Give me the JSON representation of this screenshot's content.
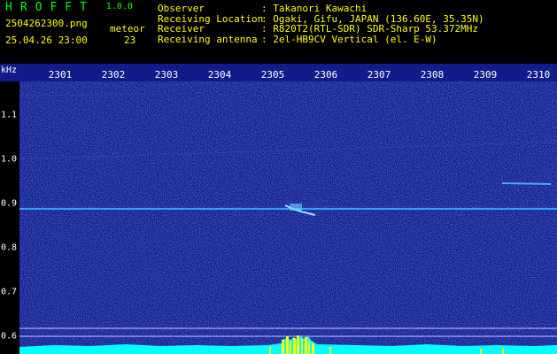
{
  "header": {
    "app_name": "HROFFT",
    "app_version": "1.0.0",
    "file_name": "2504262300.png",
    "datetime": "25.04.26 23:00",
    "meteor_label": "meteor",
    "meteor_count": "23",
    "info": [
      {
        "label": "Observer",
        "value": ": Takanori Kawachi"
      },
      {
        "label": "Receiving Location",
        "value": ": Ogaki, Gifu, JAPAN (136.60E, 35.35N)"
      },
      {
        "label": "Receiver",
        "value": ": R820T2(RTL-SDR) SDR-Sharp 53.372MHz"
      },
      {
        "label": "Receiving antenna",
        "value": ": 2el-HB9CV Vertical (el. E-W)"
      }
    ]
  },
  "spectrogram": {
    "y_unit": "kHz",
    "x_ticks": [
      "2301",
      "2302",
      "2303",
      "2304",
      "2305",
      "2306",
      "2307",
      "2308",
      "2309",
      "2310"
    ],
    "y_ticks": [
      "1.1",
      "1.0",
      "0.9",
      "0.8",
      "0.7",
      "0.6"
    ],
    "colors": {
      "background": "#101c8a",
      "signal": "#30a0ff",
      "bottom_bar": "#00ffff",
      "meteor_burst": "#ffff00"
    }
  }
}
